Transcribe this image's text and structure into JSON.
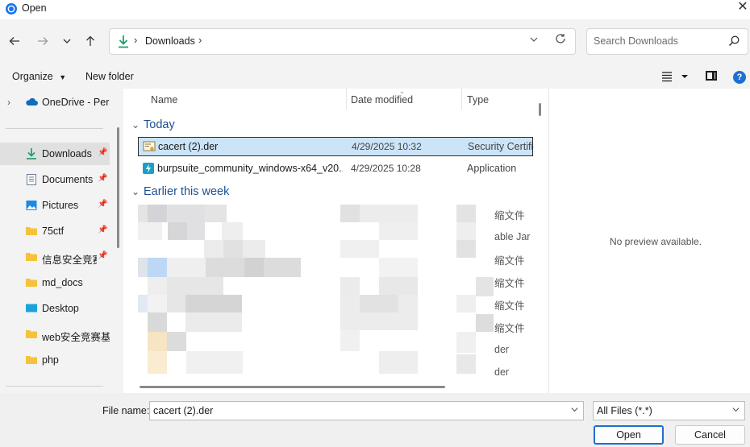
{
  "window": {
    "title": "Open"
  },
  "address": {
    "path": "Downloads"
  },
  "search": {
    "placeholder": "Search Downloads"
  },
  "toolbar": {
    "organize_label": "Organize",
    "new_folder_label": "New folder"
  },
  "nav": {
    "onedrive": "OneDrive - Pers",
    "items": [
      {
        "label": "Downloads",
        "pinned": true,
        "icon": "download-icon"
      },
      {
        "label": "Documents",
        "pinned": true,
        "icon": "document-icon"
      },
      {
        "label": "Pictures",
        "pinned": true,
        "icon": "picture-icon"
      },
      {
        "label": "75ctf",
        "pinned": true,
        "icon": "folder-icon"
      },
      {
        "label": "信息安全竞赛",
        "pinned": true,
        "icon": "folder-icon"
      },
      {
        "label": "md_docs",
        "pinned": false,
        "icon": "folder-icon"
      },
      {
        "label": "Desktop",
        "pinned": false,
        "icon": "desktop-icon"
      },
      {
        "label": "web安全竞赛基",
        "pinned": false,
        "icon": "folder-icon"
      },
      {
        "label": "php",
        "pinned": false,
        "icon": "folder-icon"
      }
    ]
  },
  "columns": {
    "name": "Name",
    "date": "Date modified",
    "type": "Type"
  },
  "groups": {
    "today": "Today",
    "earlier": "Earlier this week"
  },
  "files_today": [
    {
      "name": "cacert (2).der",
      "date": "4/29/2025 10:32",
      "type": "Security Certificate",
      "selected": true
    },
    {
      "name": "burpsuite_community_windows-x64_v20...",
      "date": "4/29/2025 10:28",
      "type": "Application",
      "selected": false
    }
  ],
  "files_earlier_types": [
    "缩文件",
    "able Jar F",
    "缩文件",
    "缩文件",
    "缩文件",
    "缩文件",
    "der",
    "der"
  ],
  "preview": {
    "text": "No preview available."
  },
  "bottom": {
    "file_name_label": "File name:",
    "file_name_value": "cacert (2).der",
    "file_type_value": "All Files (*.*)",
    "open_label": "Open",
    "cancel_label": "Cancel"
  },
  "colors": {
    "accent": "#1f6fd0",
    "group_header": "#1d4f91",
    "selection": "#cce4f7"
  }
}
